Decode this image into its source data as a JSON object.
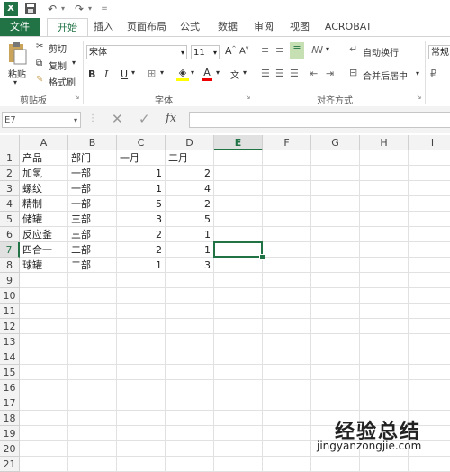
{
  "quick_access": {
    "app_icon": "excel-icon",
    "save_icon": "save-icon",
    "undo_icon": "undo-icon",
    "redo_icon": "redo-icon"
  },
  "tabs": [
    {
      "label": "文件"
    },
    {
      "label": "开始"
    },
    {
      "label": "插入"
    },
    {
      "label": "页面布局"
    },
    {
      "label": "公式"
    },
    {
      "label": "数据"
    },
    {
      "label": "审阅"
    },
    {
      "label": "视图"
    },
    {
      "label": "ACROBAT"
    }
  ],
  "ribbon": {
    "clipboard": {
      "paste": "粘贴",
      "cut": "剪切",
      "copy": "复制",
      "painter": "格式刷",
      "group": "剪贴板"
    },
    "font": {
      "name": "宋体",
      "size": "11",
      "bold": "B",
      "italic": "I",
      "underline": "U",
      "group": "字体"
    },
    "alignment": {
      "wrap": "自动换行",
      "merge": "合并后居中",
      "group": "对齐方式"
    },
    "number": {
      "format": "常规"
    }
  },
  "formula_bar": {
    "name_box": "E7",
    "fx": "fx",
    "value": ""
  },
  "columns": [
    "A",
    "B",
    "C",
    "D",
    "E",
    "F",
    "G",
    "H",
    "I"
  ],
  "rows": [
    "1",
    "2",
    "3",
    "4",
    "5",
    "6",
    "7",
    "8",
    "9",
    "10",
    "11",
    "12",
    "13",
    "14",
    "15",
    "16",
    "17",
    "18",
    "19",
    "20",
    "21"
  ],
  "table": [
    [
      "产品",
      "部门",
      "一月",
      "二月"
    ],
    [
      "加氢",
      "一部",
      "1",
      "2"
    ],
    [
      "螺纹",
      "一部",
      "1",
      "4"
    ],
    [
      "精制",
      "一部",
      "5",
      "2"
    ],
    [
      "储罐",
      "三部",
      "3",
      "5"
    ],
    [
      "反应釜",
      "三部",
      "2",
      "1"
    ],
    [
      "四合一",
      "二部",
      "2",
      "1"
    ],
    [
      "球罐",
      "二部",
      "1",
      "3"
    ]
  ],
  "selection": {
    "column": "E",
    "row": "7"
  },
  "watermark": {
    "title": "经验总结",
    "url": "jingyanzongjie.com"
  },
  "colors": {
    "accent": "#217346"
  }
}
